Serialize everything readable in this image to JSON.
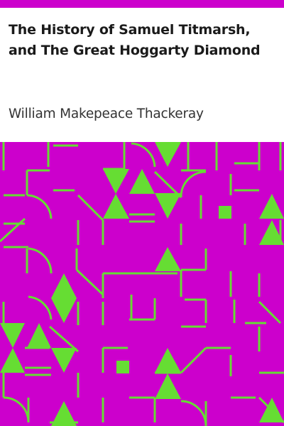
{
  "cover": {
    "title": "The History of Samuel Titmarsh, and The Great Hoggarty Diamond",
    "author": "William Makepeace Thackeray"
  },
  "colors": {
    "header_bar": "#cc00cc",
    "pattern_background": "#cc00cc",
    "pattern_shapes": "#66dd33",
    "text": "#1a1a1a"
  }
}
